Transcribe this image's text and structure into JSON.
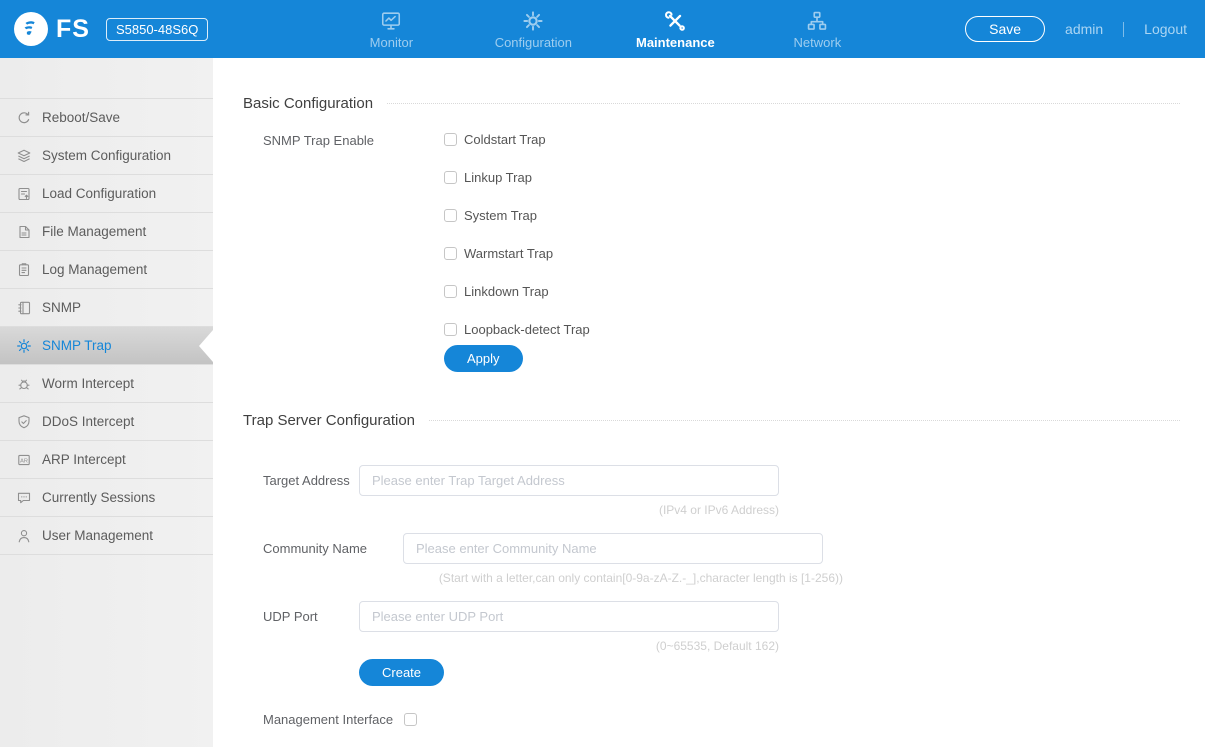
{
  "colors": {
    "accent": "#1586d8",
    "header_bg": "#1586d8",
    "sidebar_active_text": "#1586d8",
    "hint_text": "#cfcfcf"
  },
  "header": {
    "brand": "FS",
    "model": "S5850-48S6Q",
    "nav": [
      {
        "label": "Monitor",
        "icon": "monitor-icon",
        "active": false
      },
      {
        "label": "Configuration",
        "icon": "gear-icon",
        "active": false
      },
      {
        "label": "Maintenance",
        "icon": "tools-icon",
        "active": true
      },
      {
        "label": "Network",
        "icon": "network-icon",
        "active": false
      }
    ],
    "save_label": "Save",
    "user": "admin",
    "logout_label": "Logout"
  },
  "sidebar": {
    "items": [
      {
        "label": "Reboot/Save",
        "icon": "refresh-icon",
        "active": false
      },
      {
        "label": "System Configuration",
        "icon": "layers-icon",
        "active": false
      },
      {
        "label": "Load Configuration",
        "icon": "load-config-icon",
        "active": false
      },
      {
        "label": "File Management",
        "icon": "file-icon",
        "active": false
      },
      {
        "label": "Log Management",
        "icon": "clipboard-icon",
        "active": false
      },
      {
        "label": "SNMP",
        "icon": "book-icon",
        "active": false
      },
      {
        "label": "SNMP Trap",
        "icon": "gear-icon",
        "active": true
      },
      {
        "label": "Worm Intercept",
        "icon": "bug-icon",
        "active": false
      },
      {
        "label": "DDoS Intercept",
        "icon": "shield-icon",
        "active": false
      },
      {
        "label": "ARP Intercept",
        "icon": "arp-icon",
        "active": false
      },
      {
        "label": "Currently Sessions",
        "icon": "chat-icon",
        "active": false
      },
      {
        "label": "User Management",
        "icon": "user-icon",
        "active": false
      }
    ]
  },
  "main": {
    "basic": {
      "title": "Basic Configuration",
      "field_label": "SNMP Trap Enable",
      "checkboxes": [
        "Coldstart Trap",
        "Linkup Trap",
        "System Trap",
        "Warmstart Trap",
        "Linkdown Trap",
        "Loopback-detect Trap"
      ],
      "apply_label": "Apply"
    },
    "trap_server": {
      "title": "Trap Server Configuration",
      "fields": [
        {
          "label": "Target Address",
          "placeholder": "Please enter Trap Target Address",
          "hint": "(IPv4 or IPv6 Address)"
        },
        {
          "label": "Community Name",
          "placeholder": "Please enter Community Name",
          "hint": "(Start with a letter,can only contain[0-9a-zA-Z.-_],character length is [1-256))"
        },
        {
          "label": "UDP Port",
          "placeholder": "Please enter UDP Port",
          "hint": "(0~65535, Default 162)"
        }
      ],
      "create_label": "Create",
      "mgmt_label": "Management Interface"
    }
  }
}
